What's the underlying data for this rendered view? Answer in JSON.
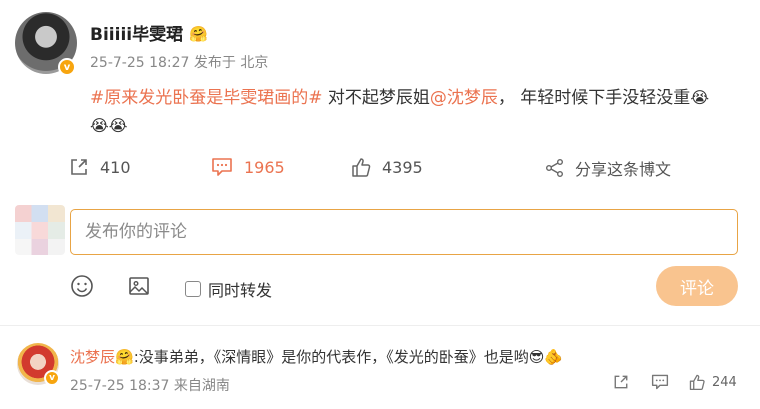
{
  "post": {
    "author": "Biiiii毕雯珺",
    "crown_emoji": "🤗",
    "verified_mark": "v",
    "timestamp": "25-7-25 18:27",
    "location": "发布于 北京",
    "hashtag": "#原来发光卧蚕是毕雯珺画的#",
    "text_part1": " 对不起梦辰姐",
    "mention": "@沈梦辰",
    "text_part2": "， 年轻时候下手没轻没重",
    "emojis": [
      "😭",
      "😭",
      "😭"
    ]
  },
  "actions": {
    "repost": {
      "icon": "share-icon",
      "count": "410"
    },
    "comment": {
      "icon": "comment-icon",
      "count": "1965"
    },
    "like": {
      "icon": "thumbs-up-icon",
      "count": "4395"
    },
    "share": {
      "icon": "share-network-icon",
      "label": "分享这条博文"
    }
  },
  "comment_box": {
    "placeholder": "发布你的评论",
    "repost_label": "同时转发",
    "submit_label": "评论"
  },
  "reply": {
    "user": "沈梦辰",
    "crown_emoji": "🤗",
    "verified_mark": "v",
    "text": ":没事弟弟，《深情眼》是你的代表作，《发光的卧蚕》也是哟",
    "emojis": [
      "😎",
      "🫵"
    ],
    "timestamp": "25-7-25 18:37",
    "source": "来自湖南",
    "like_count": "244"
  },
  "colors": {
    "accent": "#eb7350",
    "input_border": "#e8a445",
    "submit_bg": "#f9c48f",
    "verified": "#f7a50f"
  }
}
